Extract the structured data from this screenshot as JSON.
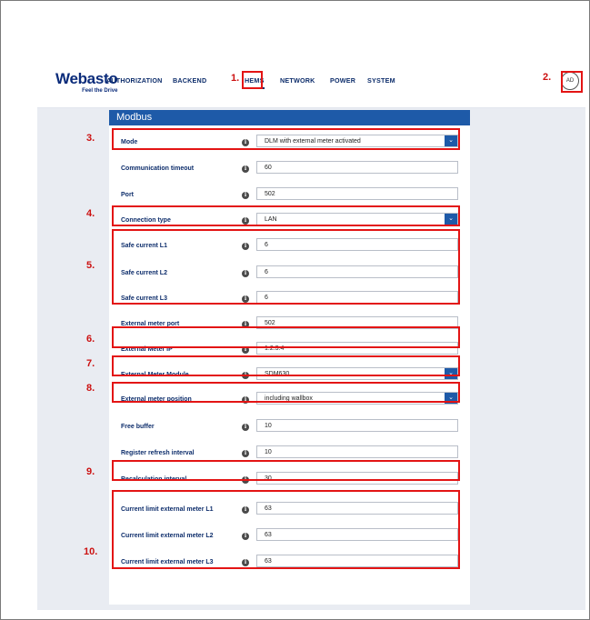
{
  "brand": {
    "name": "Webasto",
    "tagline": "Feel the Drive"
  },
  "nav": [
    {
      "label": "AUTHORIZATION",
      "active": false
    },
    {
      "label": "BACKEND",
      "active": false
    },
    {
      "label": "HEMS",
      "active": true
    },
    {
      "label": "NETWORK",
      "active": false
    },
    {
      "label": "POWER",
      "active": false
    },
    {
      "label": "SYSTEM",
      "active": false
    }
  ],
  "avatar": "AD",
  "section_title": "Modbus",
  "fields": [
    {
      "label": "Mode",
      "value": "DLM with external meter activated",
      "type": "select"
    },
    {
      "label": "Communication timeout",
      "value": "60",
      "type": "input"
    },
    {
      "label": "Port",
      "value": "502",
      "type": "input"
    },
    {
      "label": "Connection type",
      "value": "LAN",
      "type": "select"
    },
    {
      "label": "Safe current L1",
      "value": "6",
      "type": "input"
    },
    {
      "label": "Safe current L2",
      "value": "6",
      "type": "input"
    },
    {
      "label": "Safe current L3",
      "value": "6",
      "type": "input"
    },
    {
      "label": "External meter port",
      "value": "502",
      "type": "input"
    },
    {
      "label": "External Meter IP",
      "value": "1.2.3.4",
      "type": "input"
    },
    {
      "label": "External Meter Module",
      "value": "SDM630",
      "type": "select"
    },
    {
      "label": "External meter position",
      "value": "including wallbox",
      "type": "select"
    },
    {
      "label": "Free buffer",
      "value": "10",
      "type": "input"
    },
    {
      "label": "Register refresh interval",
      "value": "10",
      "type": "input"
    },
    {
      "label": "Recalculation interval",
      "value": "30",
      "type": "input"
    },
    {
      "label": "Current limit external meter L1",
      "value": "63",
      "type": "input"
    },
    {
      "label": "Current limit external meter L2",
      "value": "63",
      "type": "input"
    },
    {
      "label": "Current limit external meter L3",
      "value": "63",
      "type": "input"
    }
  ],
  "info_glyph": "i",
  "chevron_glyph": "⌄",
  "annotations": [
    "1.",
    "2.",
    "3.",
    "4.",
    "5.",
    "6.",
    "7.",
    "8.",
    "9.",
    "10."
  ],
  "highlight_color": "#e31414",
  "accent_color": "#1e5aa8"
}
